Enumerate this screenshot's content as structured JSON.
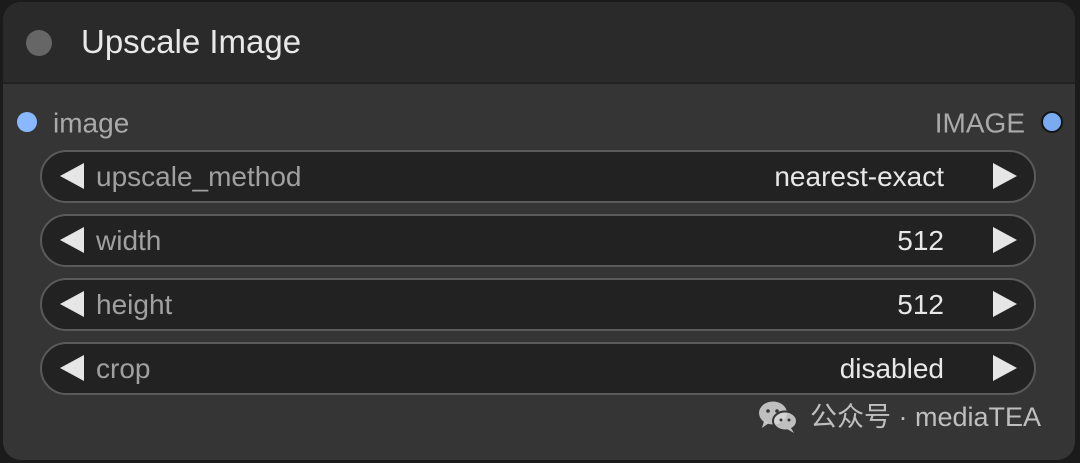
{
  "node": {
    "title": "Upscale Image",
    "input_slot": {
      "label": "image",
      "color": "#8ab8ff"
    },
    "output_slot": {
      "label": "IMAGE",
      "color": "#7aaaf0"
    }
  },
  "widgets": [
    {
      "label": "upscale_method",
      "value": "nearest-exact"
    },
    {
      "label": "width",
      "value": "512"
    },
    {
      "label": "height",
      "value": "512"
    },
    {
      "label": "crop",
      "value": "disabled"
    }
  ],
  "watermark": {
    "icon": "wechat-icon",
    "text": "公众号 · mediaTEA"
  }
}
